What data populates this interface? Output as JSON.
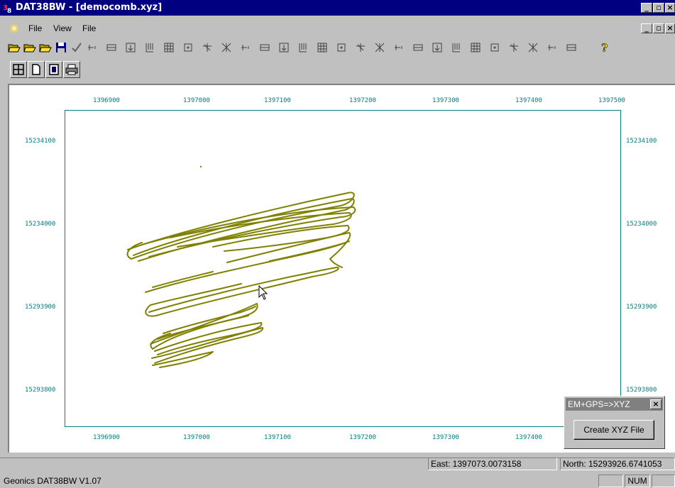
{
  "titlebar": {
    "app": "DAT38BW",
    "doc": "[democomb.xyz]",
    "separator": " - "
  },
  "menu": [
    "File",
    "View",
    "File"
  ],
  "toolbar": {
    "icons": [
      "open-folder-icon",
      "open-folder-icon",
      "open-folder-icon",
      "save-disk-icon",
      "check-icon",
      "grid-tool-icon",
      "grid-tool-icon",
      "grid-tool-icon",
      "grid-tool-icon",
      "grid-tool-icon",
      "grid-tool-icon",
      "grid-tool-icon",
      "grid-tool-icon",
      "grid-tool-icon",
      "grid-tool-icon",
      "grid-tool-icon",
      "grid-tool-icon",
      "grid-tool-icon",
      "grid-tool-icon",
      "grid-tool-icon",
      "grid-tool-icon",
      "grid-tool-icon",
      "grid-tool-icon",
      "grid-tool-icon",
      "grid-tool-icon",
      "grid-tool-icon",
      "grid-tool-icon",
      "grid-tool-icon",
      "grid-tool-icon",
      "grid-tool-icon",
      "grid-tool-icon",
      "help-icon"
    ]
  },
  "toolbar2": {
    "icons": [
      "grid-icon",
      "page-icon",
      "frame-icon",
      "print-icon"
    ]
  },
  "plot": {
    "x_ticks": [
      "1396900",
      "1397000",
      "1397100",
      "1397200",
      "1397300",
      "1397400",
      "1397500"
    ],
    "x_ticks_bottom": [
      "1396900",
      "1397000",
      "1397100",
      "1397200",
      "1397300",
      "1397400"
    ],
    "y_ticks": [
      "15234100",
      "15234000",
      "15293900",
      "15293800"
    ],
    "track_color": "#808000",
    "axis_color": "#008080"
  },
  "dialog": {
    "title": "EM+GPS=>XYZ",
    "button": "Create XYZ File"
  },
  "coords": {
    "east": "East: 1397073.0073158",
    "north": "North: 15293926.6741053"
  },
  "status": {
    "text": "Geonics DAT38BW V1.07",
    "num": "NUM"
  }
}
